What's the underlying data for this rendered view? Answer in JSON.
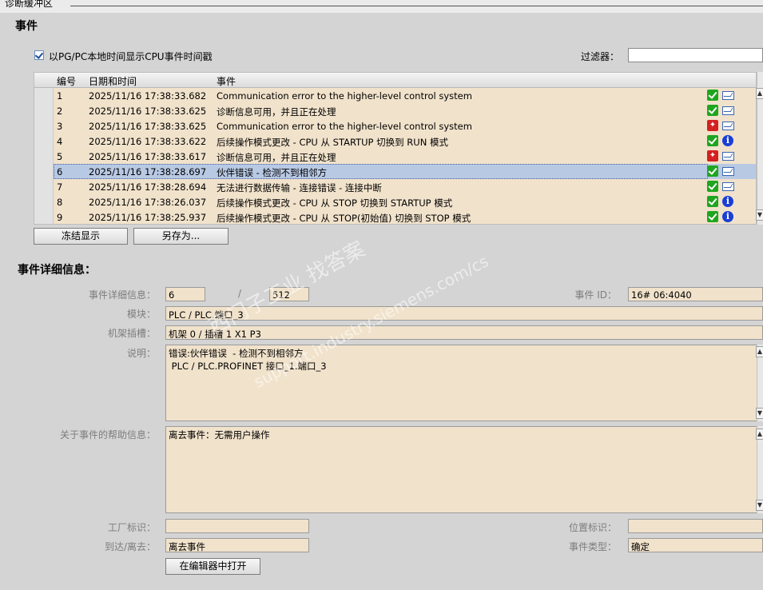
{
  "window": {
    "tab_title": "诊断缓冲区"
  },
  "events_section": {
    "title": "事件",
    "checkbox_label": "以PG/PC本地时间显示CPU事件时间戳",
    "checkbox_checked": true,
    "filter_label": "过滤器：",
    "filter_value": ""
  },
  "table": {
    "columns": [
      "编号",
      "日期和时间",
      "事件"
    ],
    "rows": [
      {
        "no": "1",
        "time": "2025/11/16 17:38:33.682",
        "event": "Communication error to the higher-level control system",
        "status_icon": "ok-check-icon",
        "type_icon": "envelope-out-icon"
      },
      {
        "no": "2",
        "time": "2025/11/16 17:38:33.625",
        "event": "诊断信息可用，并且正在处理",
        "status_icon": "ok-check-icon",
        "type_icon": "envelope-out-icon"
      },
      {
        "no": "3",
        "time": "2025/11/16 17:38:33.625",
        "event": "Communication error to the higher-level control system",
        "status_icon": "wrench-error-icon",
        "type_icon": "envelope-in-icon"
      },
      {
        "no": "4",
        "time": "2025/11/16 17:38:33.622",
        "event": "后续操作模式更改  - CPU 从 STARTUP 切换到 RUN 模式",
        "status_icon": "ok-check-icon",
        "type_icon": "info-icon"
      },
      {
        "no": "5",
        "time": "2025/11/16 17:38:33.617",
        "event": "诊断信息可用，并且正在处理",
        "status_icon": "wrench-error-icon",
        "type_icon": "envelope-in-icon"
      },
      {
        "no": "6",
        "time": "2025/11/16 17:38:28.697",
        "event": "伙伴错误  - 检测不到相邻方",
        "status_icon": "ok-check-icon",
        "type_icon": "envelope-out-icon"
      },
      {
        "no": "7",
        "time": "2025/11/16 17:38:28.694",
        "event": "无法进行数据传输  - 连接错误 - 连接中断",
        "status_icon": "ok-check-icon",
        "type_icon": "envelope-out-icon"
      },
      {
        "no": "8",
        "time": "2025/11/16 17:38:26.037",
        "event": "后续操作模式更改  - CPU 从 STOP 切换到 STARTUP 模式",
        "status_icon": "ok-check-icon",
        "type_icon": "info-icon"
      },
      {
        "no": "9",
        "time": "2025/11/16 17:38:25.937",
        "event": "后续操作模式更改  - CPU 从 STOP(初始值) 切换到 STOP 模式",
        "status_icon": "ok-check-icon",
        "type_icon": "info-icon"
      }
    ],
    "selected_row": "6"
  },
  "buttons": {
    "freeze": "冻结显示",
    "save_as": "另存为...",
    "open_editor": "在编辑器中打开"
  },
  "details": {
    "title": "事件详细信息：",
    "detail_label": "事件详细信息：",
    "detail_index": "6",
    "separator": "/",
    "detail_total": "512",
    "event_id_label": "事件 ID：",
    "event_id": "16# 06:4040",
    "module_label": "模块：",
    "module": "PLC / PLC.端口_3",
    "rack_label": "机架插槽：",
    "rack": "机架 0 / 插槽 1 X1 P3",
    "desc_label": "说明：",
    "desc": "错误:伙伴错误  - 检测不到相邻方\n PLC / PLC.PROFINET 接口_1.端口_3",
    "help_label": "关于事件的帮助信息：",
    "help": "离去事件：无需用户操作",
    "plant_label": "工厂标识：",
    "plant": "",
    "location_label": "位置标识：",
    "location": "",
    "arrive_label": "到达/离去：",
    "arrive": "离去事件",
    "type_label": "事件类型：",
    "type": "确定"
  },
  "watermark": {
    "line1": "西门子工业  找答案",
    "line2": "support.industry.siemens.com/cs"
  },
  "colors": {
    "grid_bg": "#f1e2cb",
    "selected_row": "#b8c9e4",
    "ok": "#1fa51f",
    "error": "#d42020",
    "info": "#1a3fd6"
  }
}
